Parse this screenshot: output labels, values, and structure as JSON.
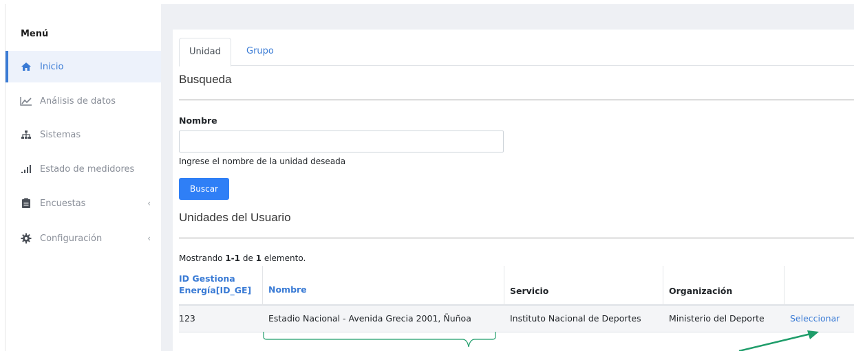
{
  "sidebar": {
    "title": "Menú",
    "items": [
      {
        "label": "Inicio",
        "icon": "home-icon"
      },
      {
        "label": "Análisis de datos",
        "icon": "chart-line-icon"
      },
      {
        "label": "Sistemas",
        "icon": "sitemap-icon"
      },
      {
        "label": "Estado de medidores",
        "icon": "signal-icon"
      },
      {
        "label": "Encuestas",
        "icon": "clipboard-icon",
        "chevron": "‹"
      },
      {
        "label": "Configuración",
        "icon": "gear-icon",
        "chevron": "‹"
      }
    ]
  },
  "tabs": [
    {
      "label": "Unidad",
      "active": true
    },
    {
      "label": "Grupo",
      "active": false
    }
  ],
  "search": {
    "section_title": "Busqueda",
    "field_label": "Nombre",
    "value": "",
    "hint": "Ingrese el nombre de la unidad deseada",
    "button_label": "Buscar"
  },
  "units": {
    "section_title": "Unidades del Usuario",
    "summary_prefix": "Mostrando ",
    "summary_range": "1-1",
    "summary_mid": " de ",
    "summary_total": "1",
    "summary_suffix": " elemento.",
    "columns": {
      "id_line1": "ID Gestiona",
      "id_line2": "Energía[ID_GE]",
      "nombre": "Nombre",
      "servicio": "Servicio",
      "organizacion": "Organización"
    },
    "rows": [
      {
        "id": "123",
        "nombre": "Estadio Nacional - Avenida Grecia 2001, Ñuñoa",
        "servicio": "Instituto Nacional de Deportes",
        "organizacion": "Ministerio del Deporte",
        "action": "Seleccionar"
      }
    ]
  },
  "colors": {
    "accent": "#3a7bd5",
    "primary_button": "#2f7ff6",
    "annotation": "#1f9d6a"
  }
}
